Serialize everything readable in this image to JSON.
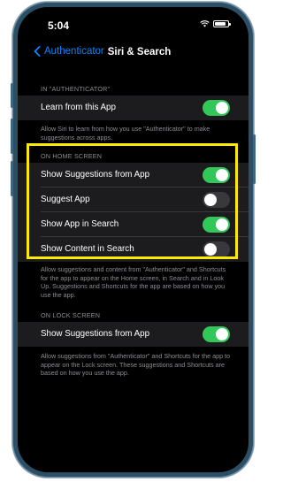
{
  "status_bar": {
    "time": "5:04"
  },
  "nav": {
    "back_label": "Authenticator",
    "title": "Siri & Search"
  },
  "section1": {
    "header": "IN \"AUTHENTICATOR\"",
    "rows": [
      {
        "label": "Learn from this App",
        "on": true
      }
    ],
    "footer": "Allow Siri to learn from how you use \"Authenticator\" to make suggestions across apps."
  },
  "section2": {
    "header": "ON HOME SCREEN",
    "rows": [
      {
        "label": "Show Suggestions from App",
        "on": true
      },
      {
        "label": "Suggest App",
        "on": false
      },
      {
        "label": "Show App in Search",
        "on": true
      },
      {
        "label": "Show Content in Search",
        "on": false
      }
    ],
    "footer": "Allow suggestions and content from \"Authenticator\" and Shortcuts for the app to appear on the Home screen, in Search and in Look Up. Suggestions and Shortcuts for the app are based on how you use the app."
  },
  "section3": {
    "header": "ON LOCK SCREEN",
    "rows": [
      {
        "label": "Show Suggestions from App",
        "on": true
      }
    ],
    "footer": "Allow suggestions from \"Authenticator\" and Shortcuts for the app to appear on the Lock screen. These suggestions and Shortcuts are based on how you use the app."
  },
  "colors": {
    "accent": "#0a84ff",
    "toggle_on": "#32c759",
    "highlight": "#ffea00"
  }
}
